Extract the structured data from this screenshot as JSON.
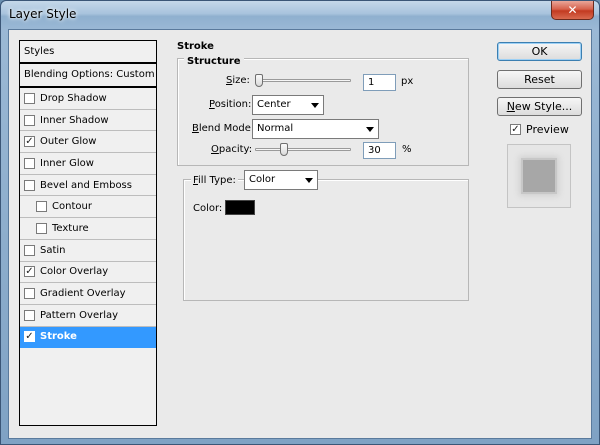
{
  "window": {
    "title": "Layer Style",
    "close_glyph": "✕"
  },
  "styles_panel": {
    "header": "Styles",
    "blending_options": "Blending Options: Custom",
    "items": [
      {
        "label": "Drop Shadow",
        "checked": false,
        "indent": false
      },
      {
        "label": "Inner Shadow",
        "checked": false,
        "indent": false
      },
      {
        "label": "Outer Glow",
        "checked": true,
        "indent": false
      },
      {
        "label": "Inner Glow",
        "checked": false,
        "indent": false
      },
      {
        "label": "Bevel and Emboss",
        "checked": false,
        "indent": false
      },
      {
        "label": "Contour",
        "checked": false,
        "indent": true
      },
      {
        "label": "Texture",
        "checked": false,
        "indent": true
      },
      {
        "label": "Satin",
        "checked": false,
        "indent": false
      },
      {
        "label": "Color Overlay",
        "checked": true,
        "indent": false
      },
      {
        "label": "Gradient Overlay",
        "checked": false,
        "indent": false
      },
      {
        "label": "Pattern Overlay",
        "checked": false,
        "indent": false
      },
      {
        "label": "Stroke",
        "checked": true,
        "indent": false,
        "selected": true
      }
    ]
  },
  "stroke": {
    "section_title": "Stroke",
    "structure_title": "Structure",
    "size": {
      "label_u": "S",
      "label_rest": "ize:",
      "value": "1",
      "unit": "px",
      "slider_fraction": 0.0
    },
    "position": {
      "label_u": "P",
      "label_rest": "osition:",
      "value": "Center"
    },
    "blend_mode": {
      "label_u": "B",
      "label_rest": "lend Mode:",
      "value": "Normal"
    },
    "opacity": {
      "label_u": "O",
      "label_rest": "pacity:",
      "value": "30",
      "unit": "%",
      "slider_fraction": 0.3
    },
    "fill_type": {
      "label_u": "F",
      "label_rest": "ill Type:",
      "value": "Color"
    },
    "color": {
      "label": "Color:",
      "swatch": "#000000"
    }
  },
  "buttons": {
    "ok": "OK",
    "reset": "Reset",
    "new_style_u": "N",
    "new_style_rest": "ew Style...",
    "preview_label": "Preview",
    "preview_checked": true
  }
}
